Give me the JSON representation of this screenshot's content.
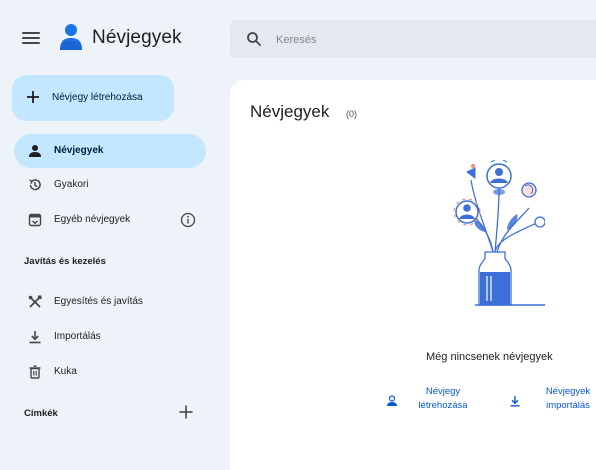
{
  "app": {
    "title": "Névjegyek"
  },
  "search": {
    "placeholder": "Keresés"
  },
  "sidebar": {
    "create_label": "Névjegy létrehozása",
    "items": [
      {
        "label": "Névjegyek",
        "icon": "person-icon",
        "active": true
      },
      {
        "label": "Gyakori",
        "icon": "history-icon",
        "active": false
      },
      {
        "label": "Egyéb névjegyek",
        "icon": "inbox-icon",
        "active": false
      }
    ],
    "section_fix": "Javítás és kezelés",
    "fix_items": [
      {
        "label": "Egyesítés és javítás",
        "icon": "tools-icon"
      },
      {
        "label": "Importálás",
        "icon": "download-icon"
      },
      {
        "label": "Kuka",
        "icon": "trash-icon"
      }
    ],
    "labels_heading": "Címkék"
  },
  "main": {
    "title": "Névjegyek",
    "count": "(0)",
    "empty_message": "Még nincsenek névjegyek",
    "actions": [
      {
        "label_line1": "Névjegy",
        "label_line2": "létrehozása",
        "icon": "person-add-icon"
      },
      {
        "label_line1": "Névjegyek",
        "label_line2": "importálás",
        "icon": "download-icon"
      }
    ]
  },
  "colors": {
    "accent": "#0b57d0",
    "active_bg": "#c2e7ff",
    "page_bg": "#eef2f9",
    "illustration_blue": "#3d6fd8"
  }
}
